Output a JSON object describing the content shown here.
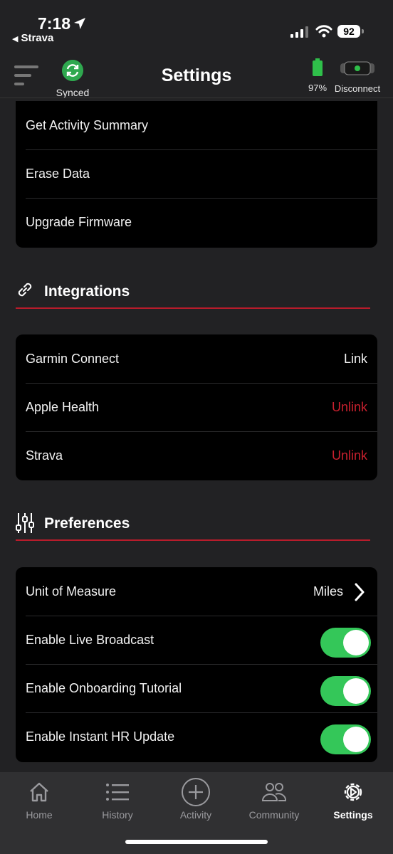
{
  "status_bar": {
    "time": "7:18",
    "back_app": "Strava",
    "battery": "92"
  },
  "header": {
    "title": "Settings",
    "sync_label": "Synced",
    "battery_pct": "97%",
    "disconnect_label": "Disconnect"
  },
  "device_menu": {
    "items": [
      "Get Activity Summary",
      "Erase Data",
      "Upgrade Firmware"
    ]
  },
  "integrations": {
    "title": "Integrations",
    "items": [
      {
        "label": "Garmin Connect",
        "action": "Link"
      },
      {
        "label": "Apple Health",
        "action": "Unlink"
      },
      {
        "label": "Strava",
        "action": "Unlink"
      }
    ]
  },
  "preferences": {
    "title": "Preferences",
    "unit_label": "Unit of Measure",
    "unit_value": "Miles",
    "toggles": [
      {
        "label": "Enable Live Broadcast",
        "on": true
      },
      {
        "label": "Enable Onboarding Tutorial",
        "on": true
      },
      {
        "label": "Enable Instant HR Update",
        "on": true
      }
    ]
  },
  "tabs": [
    {
      "label": "Home",
      "icon": "home-icon"
    },
    {
      "label": "History",
      "icon": "list-icon"
    },
    {
      "label": "Activity",
      "icon": "plus-circle-icon"
    },
    {
      "label": "Community",
      "icon": "people-icon"
    },
    {
      "label": "Settings",
      "icon": "gear-icon",
      "active": true
    }
  ],
  "colors": {
    "accent_red": "#c8202e",
    "toggle_green": "#34c759",
    "sync_green": "#2fa84f"
  }
}
